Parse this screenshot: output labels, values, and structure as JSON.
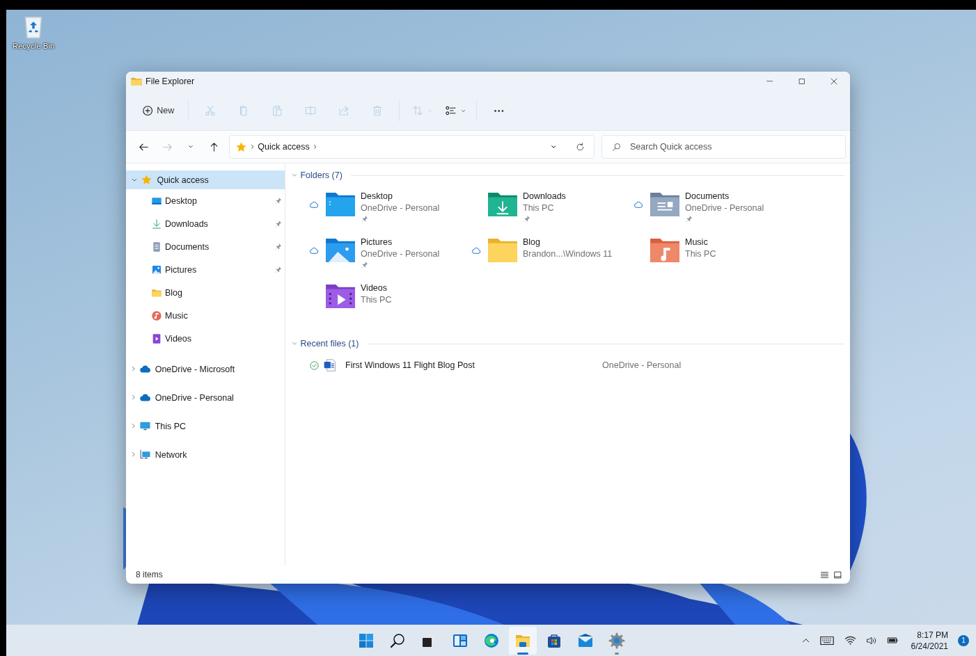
{
  "desktop_icons": [
    {
      "label": "Recycle Bin"
    }
  ],
  "window": {
    "title": "File Explorer"
  },
  "toolbar": [
    {
      "kind": "new",
      "label": "New",
      "disabled": false
    },
    {
      "kind": "cut",
      "disabled": true
    },
    {
      "kind": "copy",
      "disabled": true
    },
    {
      "kind": "paste",
      "disabled": true
    },
    {
      "kind": "rename",
      "disabled": true
    },
    {
      "kind": "share",
      "disabled": true
    },
    {
      "kind": "delete",
      "disabled": true
    },
    {
      "kind": "sort",
      "disabled": true
    },
    {
      "kind": "view",
      "disabled": false
    },
    {
      "kind": "more",
      "disabled": false
    }
  ],
  "navigation": [
    {
      "kind": "back",
      "disabled": false
    },
    {
      "kind": "forward",
      "disabled": true
    },
    {
      "kind": "recent",
      "disabled": false
    },
    {
      "kind": "up",
      "disabled": false
    }
  ],
  "address": {
    "breadcrumb": [
      "Quick access"
    ]
  },
  "search": {
    "placeholder": "Search Quick access"
  },
  "sidebar": {
    "items": [
      {
        "label": "Quick access",
        "kind": "star",
        "expanded": true,
        "selected": true,
        "children": [
          {
            "label": "Desktop",
            "kind": "desktop",
            "pinned": true,
            "selected": false
          },
          {
            "label": "Downloads",
            "kind": "download",
            "pinned": true,
            "selected": false
          },
          {
            "label": "Documents",
            "kind": "documents",
            "pinned": true,
            "selected": false
          },
          {
            "label": "Pictures",
            "kind": "pictures",
            "pinned": true,
            "selected": false
          },
          {
            "label": "Blog",
            "kind": "folder",
            "pinned": false,
            "selected": false
          },
          {
            "label": "Music",
            "kind": "music",
            "pinned": false,
            "selected": false
          },
          {
            "label": "Videos",
            "kind": "videos",
            "pinned": false,
            "selected": false
          }
        ]
      },
      {
        "label": "OneDrive - Microsoft",
        "kind": "cloud",
        "expanded": false,
        "selected": false
      },
      {
        "label": "OneDrive - Personal",
        "kind": "cloud",
        "expanded": false,
        "selected": false
      },
      {
        "label": "This PC",
        "kind": "pc",
        "expanded": false,
        "selected": false
      },
      {
        "label": "Network",
        "kind": "network",
        "expanded": false,
        "selected": false
      }
    ]
  },
  "folders": {
    "heading": "Folders (7)",
    "expanded": true,
    "items": [
      {
        "name": "Desktop",
        "location": "OneDrive - Personal",
        "kind": "desktop",
        "cloud": true,
        "pinned": true
      },
      {
        "name": "Downloads",
        "location": "This PC",
        "kind": "download",
        "cloud": false,
        "pinned": true
      },
      {
        "name": "Documents",
        "location": "OneDrive - Personal",
        "kind": "documents",
        "cloud": true,
        "pinned": true
      },
      {
        "name": "Pictures",
        "location": "OneDrive - Personal",
        "kind": "pictures",
        "cloud": true,
        "pinned": true
      },
      {
        "name": "Blog",
        "location": "Brandon...\\Windows 11",
        "kind": "folder",
        "cloud": true,
        "pinned": false
      },
      {
        "name": "Music",
        "location": "This PC",
        "kind": "music",
        "cloud": false,
        "pinned": false
      },
      {
        "name": "Videos",
        "location": "This PC",
        "kind": "videos",
        "cloud": false,
        "pinned": false
      }
    ]
  },
  "recent_files": {
    "heading": "Recent files (1)",
    "expanded": true,
    "items": [
      {
        "name": "First Windows 11 Flight Blog Post",
        "location": "OneDrive - Personal",
        "synced": true
      }
    ]
  },
  "status_bar": {
    "count": "8 items"
  },
  "taskbar": {
    "apps": [
      {
        "kind": "start",
        "selected": false,
        "running": false
      },
      {
        "kind": "search",
        "selected": false,
        "running": false
      },
      {
        "kind": "taskview",
        "selected": false,
        "running": false
      },
      {
        "kind": "widgets",
        "selected": false,
        "running": false
      },
      {
        "kind": "browser",
        "selected": false,
        "running": false
      },
      {
        "kind": "explorer",
        "selected": true,
        "running": true
      },
      {
        "kind": "store",
        "selected": false,
        "running": false
      },
      {
        "kind": "mail",
        "selected": false,
        "running": false
      },
      {
        "kind": "settings",
        "selected": false,
        "running": true
      }
    ],
    "time": "8:17 PM",
    "date": "6/24/2021",
    "notifications": "1"
  }
}
